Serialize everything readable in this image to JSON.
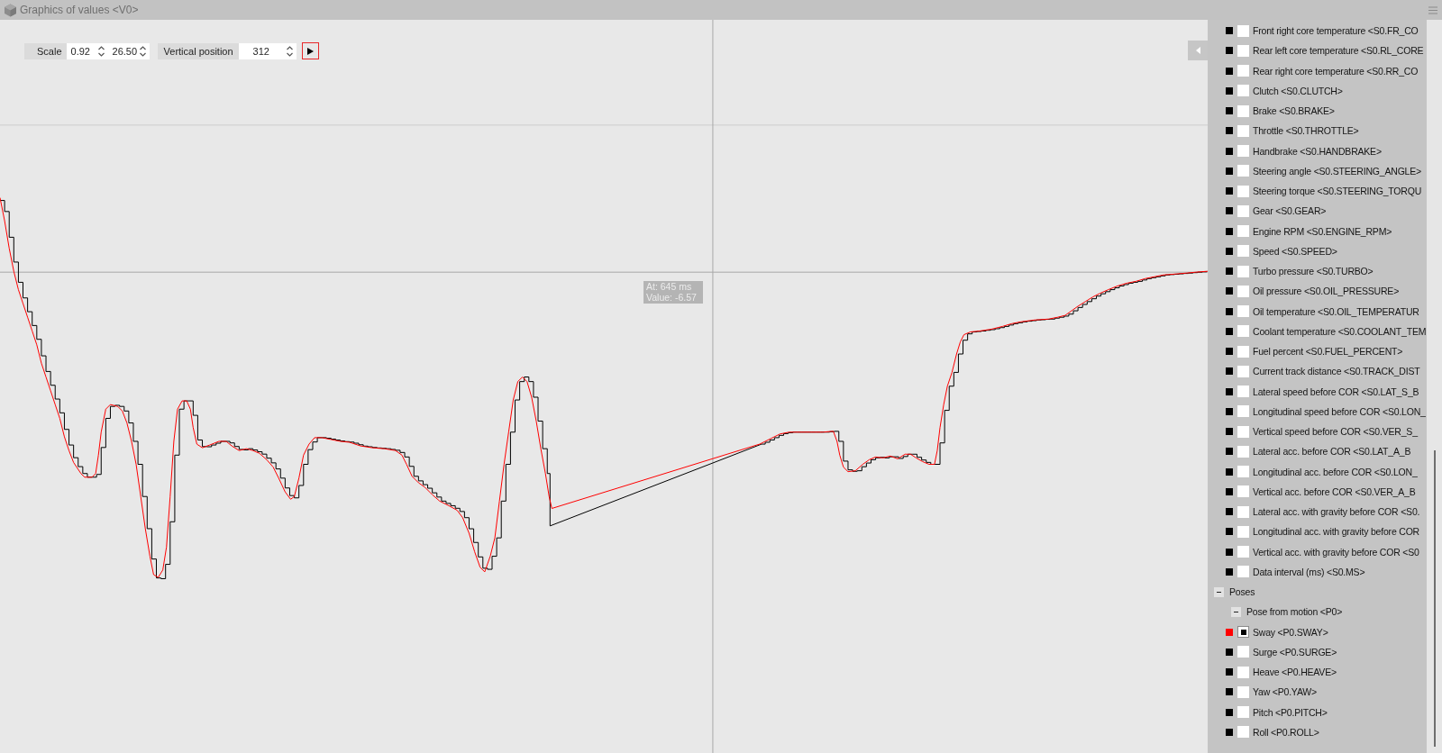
{
  "window": {
    "title": "Graphics of values <V0>"
  },
  "toolbar": {
    "scale": {
      "label": "Scale",
      "values": [
        "0.92",
        "26.50"
      ]
    },
    "vertical_position": {
      "label": "Vertical position",
      "value": "312"
    },
    "play_button": {
      "active": true
    }
  },
  "cursor_tooltip": {
    "lines": [
      "At: 645 ms",
      "Value: -6.57"
    ]
  },
  "signal_tree": [
    {
      "children": [
        {
          "children": [
            {
              "label": "Front right core temperature <S0.FR_CO",
              "color": "#000000",
              "checked": false
            },
            {
              "label": "Rear left core temperature <S0.RL_CORE",
              "color": "#000000",
              "checked": false
            },
            {
              "label": "Rear right core temperature <S0.RR_CO",
              "color": "#000000",
              "checked": false
            },
            {
              "label": "Clutch <S0.CLUTCH>",
              "color": "#000000",
              "checked": false
            },
            {
              "label": "Brake <S0.BRAKE>",
              "color": "#000000",
              "checked": false
            },
            {
              "label": "Throttle <S0.THROTTLE>",
              "color": "#000000",
              "checked": false
            },
            {
              "label": "Handbrake <S0.HANDBRAKE>",
              "color": "#000000",
              "checked": false
            },
            {
              "label": "Steering angle <S0.STEERING_ANGLE>",
              "color": "#000000",
              "checked": false
            },
            {
              "label": "Steering torque <S0.STEERING_TORQU",
              "color": "#000000",
              "checked": false
            },
            {
              "label": "Gear <S0.GEAR>",
              "color": "#000000",
              "checked": false
            },
            {
              "label": "Engine RPM <S0.ENGINE_RPM>",
              "color": "#000000",
              "checked": false
            },
            {
              "label": "Speed <S0.SPEED>",
              "color": "#000000",
              "checked": false
            },
            {
              "label": "Turbo pressure <S0.TURBO>",
              "color": "#000000",
              "checked": false
            },
            {
              "label": "Oil pressure <S0.OIL_PRESSURE>",
              "color": "#000000",
              "checked": false
            },
            {
              "label": "Oil temperature <S0.OIL_TEMPERATUR",
              "color": "#000000",
              "checked": false
            },
            {
              "label": "Coolant temperature <S0.COOLANT_TEM",
              "color": "#000000",
              "checked": false
            },
            {
              "label": "Fuel percent <S0.FUEL_PERCENT>",
              "color": "#000000",
              "checked": false
            },
            {
              "label": "Current track distance <S0.TRACK_DIST",
              "color": "#000000",
              "checked": false
            },
            {
              "label": "Lateral speed before COR <S0.LAT_S_B",
              "color": "#000000",
              "checked": false
            },
            {
              "label": "Longitudinal speed before COR <S0.LON_",
              "color": "#000000",
              "checked": false
            },
            {
              "label": "Vertical speed before COR <S0.VER_S_",
              "color": "#000000",
              "checked": false
            },
            {
              "label": "Lateral acc. before COR <S0.LAT_A_B",
              "color": "#000000",
              "checked": false
            },
            {
              "label": "Longitudinal acc. before COR <S0.LON_",
              "color": "#000000",
              "checked": false
            },
            {
              "label": "Vertical acc. before COR <S0.VER_A_B",
              "color": "#000000",
              "checked": false
            },
            {
              "label": "Lateral acc. with gravity before COR <S0.",
              "color": "#000000",
              "checked": false
            },
            {
              "label": "Longitudinal acc. with gravity before COR",
              "color": "#000000",
              "checked": false
            },
            {
              "label": "Vertical acc. with gravity before COR <S0",
              "color": "#000000",
              "checked": false
            },
            {
              "label": "Data interval (ms) <S0.MS>",
              "color": "#000000",
              "checked": false
            }
          ]
        }
      ]
    },
    {
      "label": "Poses",
      "expanded": true,
      "children": [
        {
          "label": "Pose from motion <P0>",
          "expanded": true,
          "children": [
            {
              "label": "Sway <P0.SWAY>",
              "color": "#ff0000",
              "checked": true
            },
            {
              "label": "Surge <P0.SURGE>",
              "color": "#000000",
              "checked": false
            },
            {
              "label": "Heave <P0.HEAVE>",
              "color": "#000000",
              "checked": false
            },
            {
              "label": "Yaw <P0.YAW>",
              "color": "#000000",
              "checked": false
            },
            {
              "label": "Pitch <P0.PITCH>",
              "color": "#000000",
              "checked": false
            },
            {
              "label": "Roll <P0.ROLL>",
              "color": "#000000",
              "checked": false
            }
          ]
        }
      ]
    }
  ]
}
